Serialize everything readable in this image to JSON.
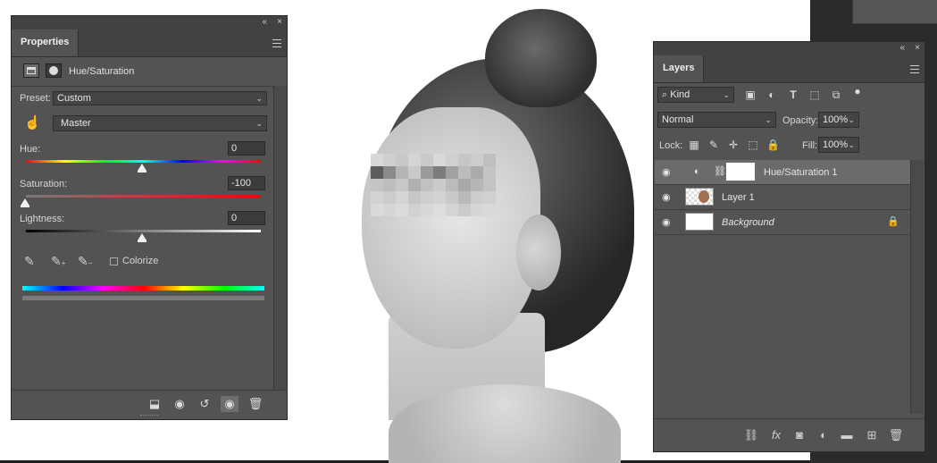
{
  "window_controls": {
    "collapse": "«",
    "close": "×"
  },
  "properties": {
    "tab_label": "Properties",
    "title": "Hue/Saturation",
    "preset_label": "Preset:",
    "preset_value": "Custom",
    "channel_value": "Master",
    "hue": {
      "label": "Hue:",
      "value": "0",
      "level_fraction": 0.5
    },
    "saturation": {
      "label": "Saturation:",
      "value": "-100",
      "level_fraction": 0.0
    },
    "lightness": {
      "label": "Lightness:",
      "value": "0",
      "level_fraction": 0.5
    },
    "colorize_label": "Colorize",
    "colorize_checked": false,
    "icons": {
      "adjustment": "hue-saturation-grid-icon",
      "mask": "layer-mask-icon",
      "targeted_adjust": "hand-pointer-icon",
      "eyedropper": "eyedropper-icon",
      "eyedropper_add": "eyedropper-plus-icon",
      "eyedropper_subtract": "eyedropper-minus-icon",
      "clip": "clip-to-layer-icon",
      "view_previous": "view-previous-state-icon",
      "reset": "reset-icon",
      "visibility": "eye-icon",
      "delete": "trash-icon"
    }
  },
  "layers": {
    "tab_label": "Layers",
    "filter_kind": "Kind",
    "blend_mode": "Normal",
    "opacity_label": "Opacity:",
    "opacity_value": "100%",
    "lock_label": "Lock:",
    "fill_label": "Fill:",
    "fill_value": "100%",
    "items": [
      {
        "name": "Hue/Saturation 1",
        "selected": true,
        "italic": false
      },
      {
        "name": "Layer 1",
        "selected": false,
        "italic": false
      },
      {
        "name": "Background",
        "selected": false,
        "italic": true
      }
    ],
    "footer_icons": [
      "link-icon",
      "fx-icon",
      "add-mask-icon",
      "adjustment-layer-icon",
      "folder-icon",
      "new-layer-icon",
      "trash-icon"
    ]
  },
  "colors": {
    "panel_bg": "#535353",
    "panel_header": "#424242",
    "selected_row": "#6b6b6b"
  }
}
